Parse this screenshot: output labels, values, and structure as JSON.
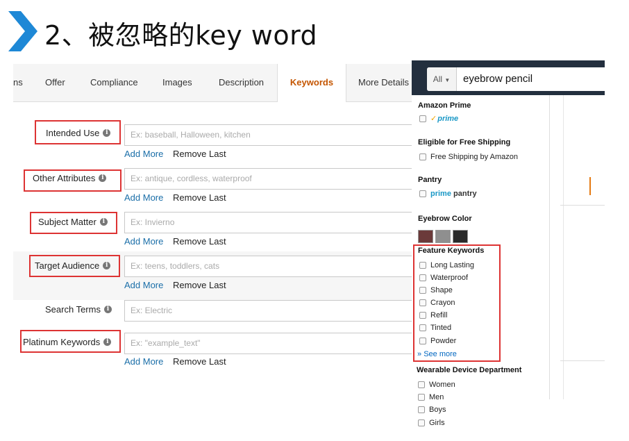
{
  "slide": {
    "title": "2、被忽略的key word"
  },
  "form": {
    "tabs": [
      {
        "label": "ns"
      },
      {
        "label": "Offer"
      },
      {
        "label": "Compliance"
      },
      {
        "label": "Images"
      },
      {
        "label": "Description"
      },
      {
        "label": "Keywords"
      },
      {
        "label": "More Details"
      }
    ],
    "active_tab": "Keywords",
    "fields": [
      {
        "label": "Intended Use",
        "placeholder": "Ex: baseball, Halloween, kitchen",
        "highlighted": true,
        "has_links": true
      },
      {
        "label": "Other Attributes",
        "placeholder": "Ex: antique, cordless, waterproof",
        "highlighted": true,
        "has_links": true
      },
      {
        "label": "Subject Matter",
        "placeholder": "Ex: Invierno",
        "highlighted": true,
        "has_links": true
      },
      {
        "label": "Target Audience",
        "placeholder": "Ex: teens, toddlers, cats",
        "highlighted": true,
        "has_links": true
      },
      {
        "label": "Search Terms",
        "placeholder": "Ex: Electric",
        "highlighted": false,
        "has_links": false
      },
      {
        "label": "Platinum Keywords",
        "placeholder": "Ex: \"example_text\"",
        "highlighted": true,
        "has_links": true
      }
    ],
    "add_more_label": "Add More",
    "remove_last_label": "Remove Last",
    "info_glyph": "i"
  },
  "amazon": {
    "search_scope": "All",
    "search_query": "eyebrow pencil",
    "amazon_prime": {
      "heading": "Amazon Prime",
      "option": "prime"
    },
    "free_shipping": {
      "heading": "Eligible for Free Shipping",
      "option": "Free Shipping by Amazon"
    },
    "pantry": {
      "heading": "Pantry",
      "prime": "prime",
      "pantry": "pantry"
    },
    "eyebrow_color": {
      "heading": "Eyebrow Color",
      "swatches": [
        "#6b3a3a",
        "#8f8f8f",
        "#2a2a2a"
      ]
    },
    "feature_keywords": {
      "heading": "Feature Keywords",
      "options": [
        "Long Lasting",
        "Waterproof",
        "Shape",
        "Crayon",
        "Refill",
        "Tinted",
        "Powder"
      ],
      "see_more": "See more"
    },
    "wearable": {
      "heading": "Wearable Device Department",
      "options": [
        "Women",
        "Men",
        "Boys",
        "Girls"
      ]
    }
  },
  "colors": {
    "accent_red": "#d33333",
    "chevron_blue": "#1e88d6",
    "tab_active": "#c45500",
    "link_blue": "#1a6ea8"
  }
}
